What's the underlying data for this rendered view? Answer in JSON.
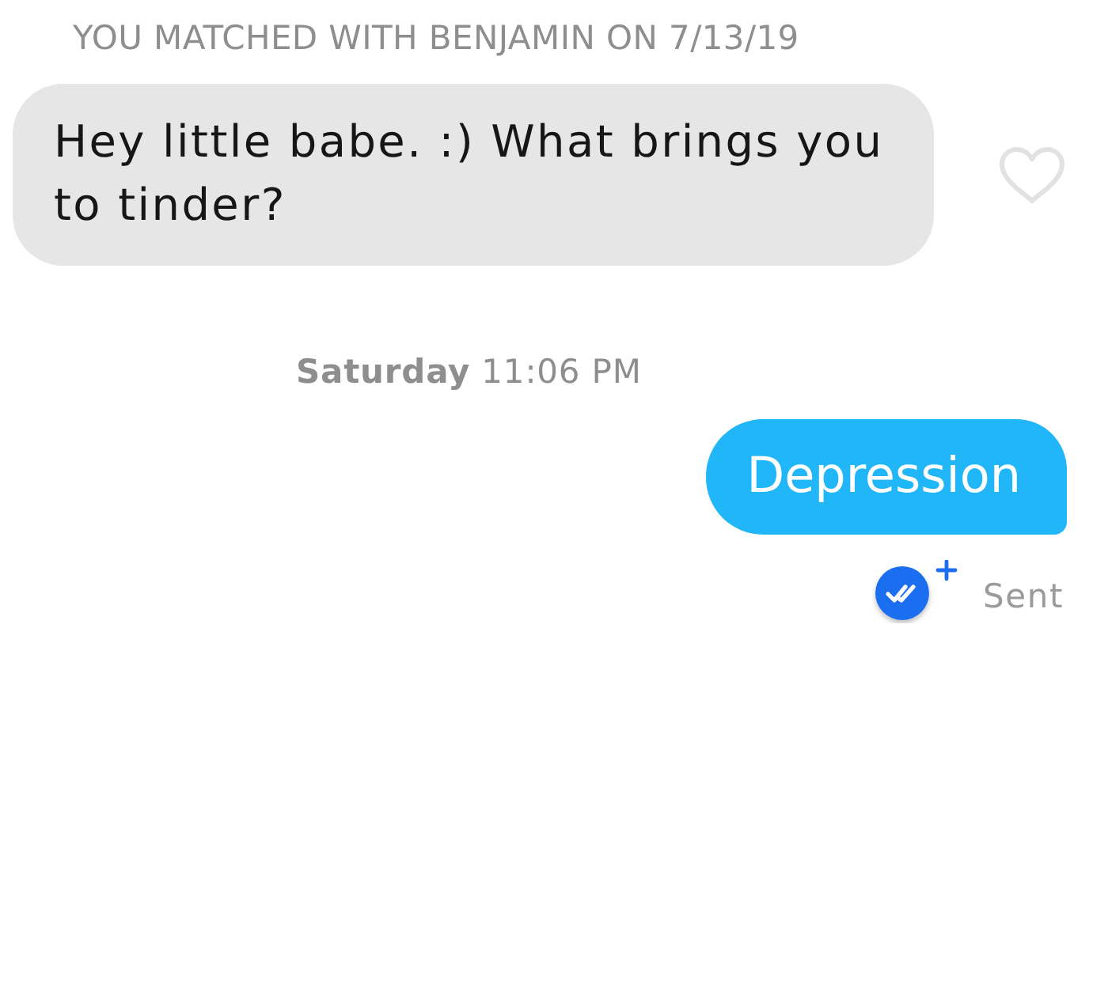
{
  "thread": [
    {
      "kind": "notice",
      "text": "YOU MATCHED WITH BENJAMIN ON 7/13/19"
    },
    {
      "kind": "received",
      "text": "Hey little babe. :) What brings you to tinder?",
      "liked": false
    },
    {
      "kind": "timestamp",
      "text": "**Saturday** 11:06 PM"
    },
    {
      "kind": "sent",
      "text": "Depression",
      "status": "Sent"
    }
  ]
}
